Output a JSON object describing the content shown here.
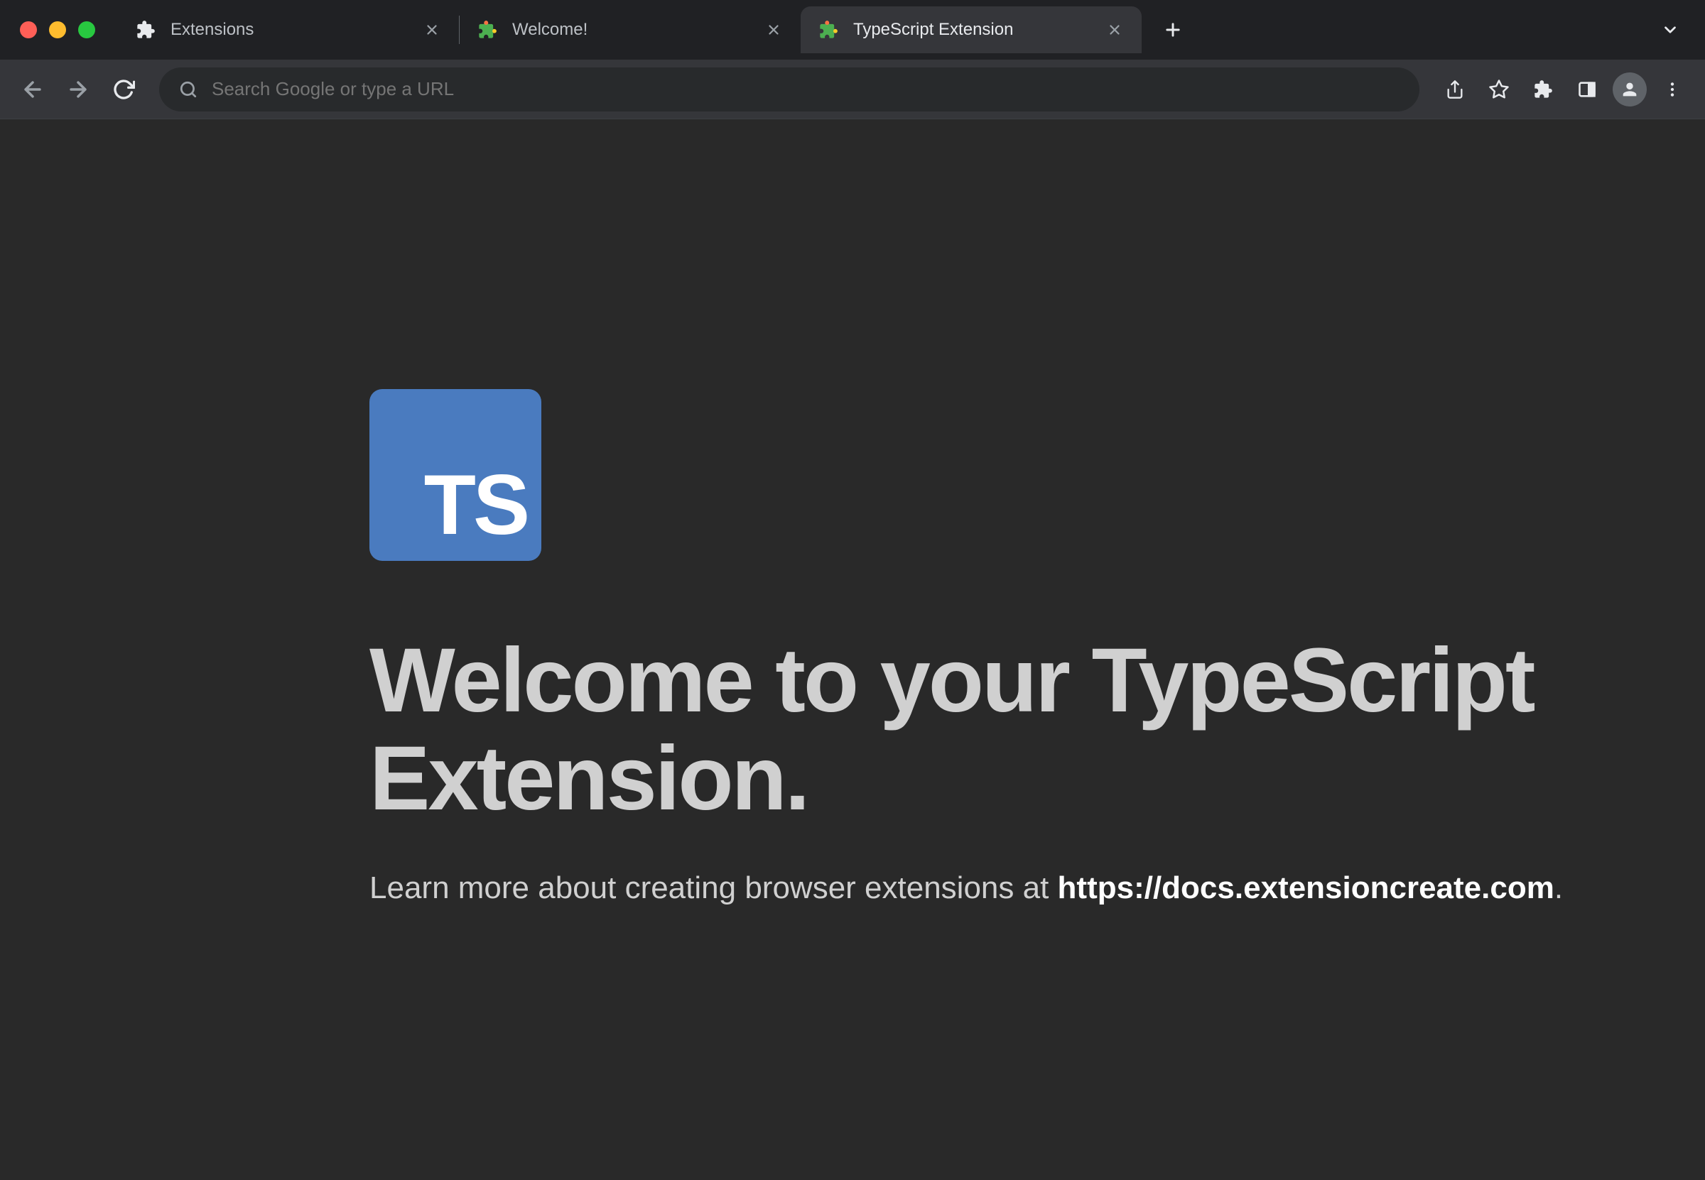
{
  "window": {
    "tabs": [
      {
        "title": "Extensions",
        "icon": "puzzle"
      },
      {
        "title": "Welcome!",
        "icon": "puzzle-color"
      },
      {
        "title": "TypeScript Extension",
        "icon": "puzzle-color"
      }
    ],
    "active_tab_index": 2
  },
  "toolbar": {
    "omnibox_placeholder": "Search Google or type a URL"
  },
  "content": {
    "logo_text": "TS",
    "headline": "Welcome to your TypeScript Extension.",
    "subtext_prefix": "Learn more about creating browser extensions at ",
    "subtext_link": "https://docs.extensioncreate.com",
    "subtext_suffix": "."
  }
}
